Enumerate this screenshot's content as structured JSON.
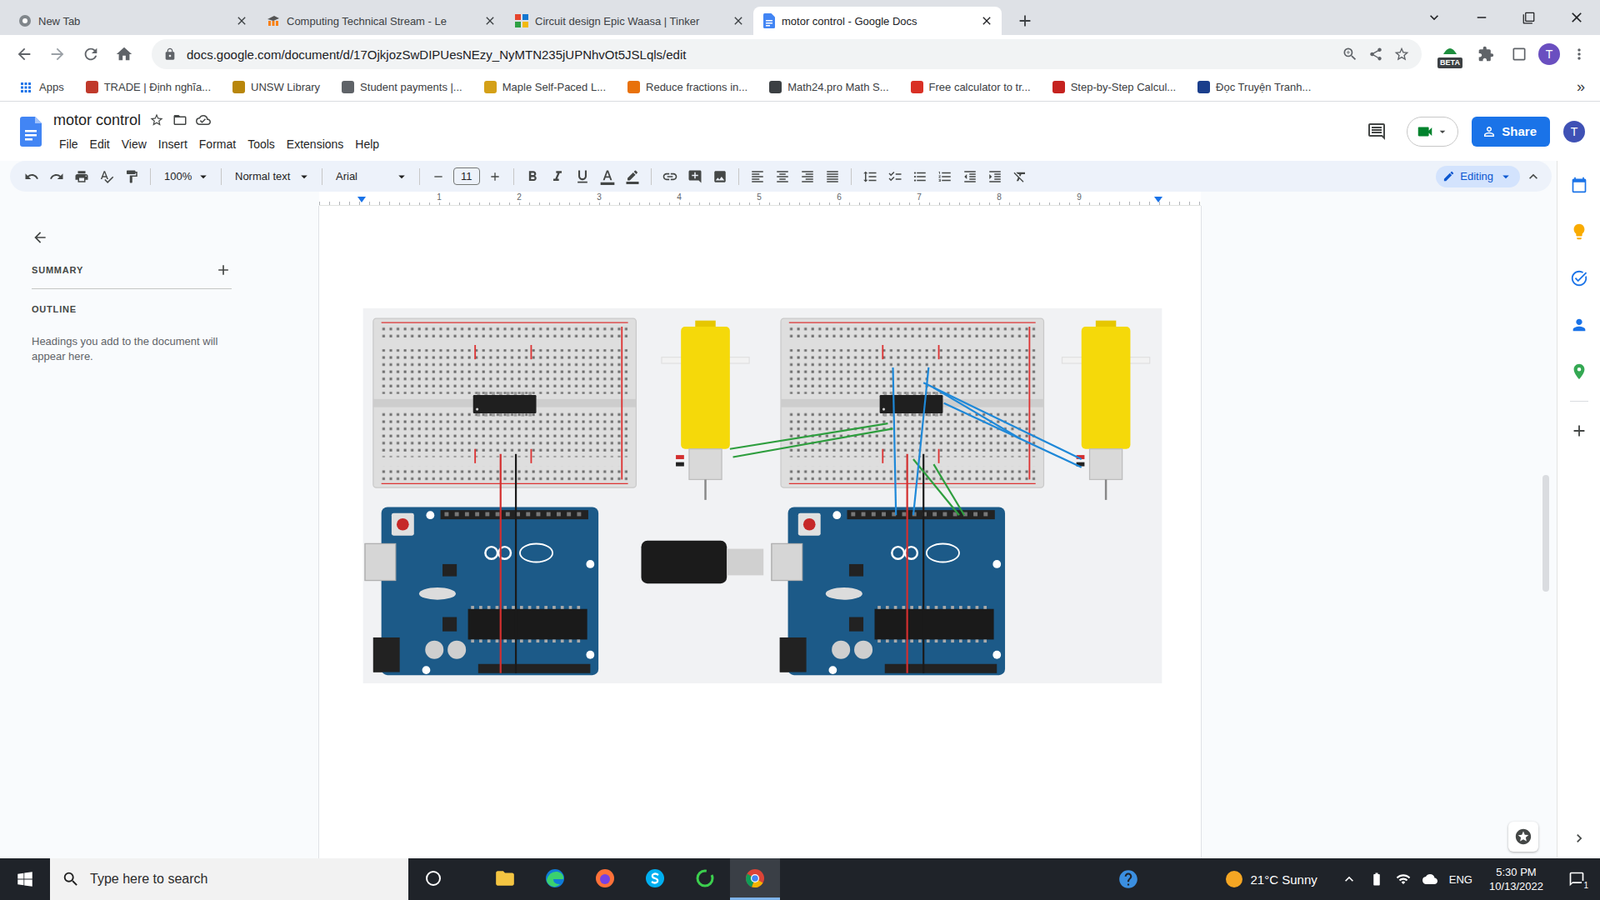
{
  "browser": {
    "tabs": [
      {
        "label": "New Tab",
        "selected": false,
        "kind": "chrome"
      },
      {
        "label": "Computing Technical Stream - Le",
        "selected": false,
        "kind": "moodle"
      },
      {
        "label": "Circuit design Epic Waasa | Tinker",
        "selected": false,
        "kind": "tinkercad"
      },
      {
        "label": "motor control - Google Docs",
        "selected": true,
        "kind": "docs"
      }
    ],
    "url": "docs.google.com/document/d/17OjkjozSwDIPUesNEzy_NyMTN235jUPNhvOt5JSLqls/edit",
    "beta_badge": "BETA",
    "profile": "T",
    "apps_label": "Apps",
    "bookmarks": [
      {
        "label": "TRADE | Định nghĩa...",
        "color": "#c0392b"
      },
      {
        "label": "UNSW Library",
        "color": "#b8860b"
      },
      {
        "label": "Student payments |...",
        "color": "#5f6368"
      },
      {
        "label": "Maple Self-Paced L...",
        "color": "#d4a017"
      },
      {
        "label": "Reduce fractions in...",
        "color": "#e8710a"
      },
      {
        "label": "Math24.pro Math S...",
        "color": "#3c4043"
      },
      {
        "label": "Free calculator to tr...",
        "color": "#d93025"
      },
      {
        "label": "Step-by-Step Calcul...",
        "color": "#c5221f"
      },
      {
        "label": "Đọc Truyện Tranh...",
        "color": "#1a3e8c"
      }
    ],
    "more_bookmarks": "»"
  },
  "docs": {
    "title": "motor control",
    "menu": [
      "File",
      "Edit",
      "View",
      "Insert",
      "Format",
      "Tools",
      "Extensions",
      "Help"
    ],
    "share": "Share",
    "avatar": "T",
    "toolbar": {
      "zoom": "100%",
      "style": "Normal text",
      "font": "Arial",
      "size": "11",
      "mode": "Editing"
    },
    "ruler": [
      "1",
      "2",
      "3",
      "4",
      "5",
      "6",
      "7",
      "8",
      "9"
    ],
    "sidebar": {
      "summary": "SUMMARY",
      "outline": "OUTLINE",
      "hint": "Headings you add to the document will appear here."
    }
  },
  "taskbar": {
    "search_placeholder": "Type here to search",
    "apps": [
      {
        "kind": "taskview",
        "selected": false
      },
      {
        "kind": "explorer",
        "selected": false
      },
      {
        "kind": "edge",
        "selected": false
      },
      {
        "kind": "firefox",
        "selected": false
      },
      {
        "kind": "skype",
        "selected": false
      },
      {
        "kind": "ring",
        "selected": false
      },
      {
        "kind": "chrome",
        "selected": true
      }
    ],
    "weather": "21°C Sunny",
    "language": "ENG",
    "time": "5:30 PM",
    "date": "10/13/2022",
    "notifications": "1"
  }
}
